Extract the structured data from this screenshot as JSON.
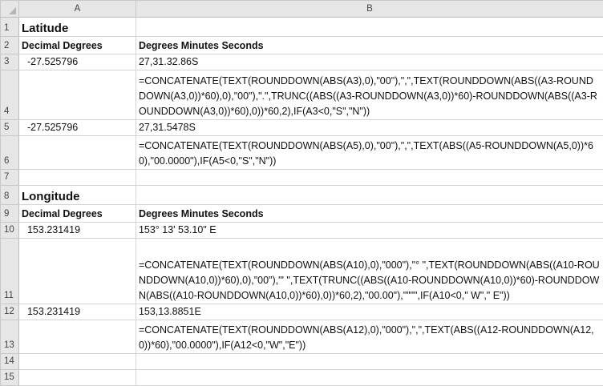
{
  "columns": [
    "A",
    "B"
  ],
  "rows": [
    {
      "num": "1",
      "a": "Latitude",
      "b": ""
    },
    {
      "num": "2",
      "a": "Decimal Degrees",
      "b": "Degrees Minutes Seconds"
    },
    {
      "num": "3",
      "a": "-27.525796",
      "b": "27,31.32.86S"
    },
    {
      "num": "4",
      "a": "",
      "b": "=CONCATENATE(TEXT(ROUNDDOWN(ABS(A3),0),\"00\"),\",\",TEXT(ROUNDDOWN(ABS((A3-ROUNDDOWN(A3,0))*60),0),\"00\"),\".\",TRUNC((ABS((A3-ROUNDDOWN(A3,0))*60)-ROUNDDOWN(ABS((A3-ROUNDDOWN(A3,0))*60),0))*60,2),IF(A3<0,\"S\",\"N\"))"
    },
    {
      "num": "5",
      "a": "-27.525796",
      "b": "27,31.5478S"
    },
    {
      "num": "6",
      "a": "",
      "b": "=CONCATENATE(TEXT(ROUNDDOWN(ABS(A5),0),\"00\"),\",\",TEXT(ABS((A5-ROUNDDOWN(A5,0))*60),\"00.0000\"),IF(A5<0,\"S\",\"N\"))"
    },
    {
      "num": "7",
      "a": "",
      "b": ""
    },
    {
      "num": "8",
      "a": "Longitude",
      "b": ""
    },
    {
      "num": "9",
      "a": "Decimal Degrees",
      "b": "Degrees Minutes Seconds"
    },
    {
      "num": "10",
      "a": "153.231419",
      "b": "153° 13' 53.10\" E"
    },
    {
      "num": "11",
      "a": "",
      "b": "=CONCATENATE(TEXT(ROUNDDOWN(ABS(A10),0),\"000\"),\"° \",TEXT(ROUNDDOWN(ABS((A10-ROUNDDOWN(A10,0))*60),0),\"00\"),\"' \",TEXT(TRUNC((ABS((A10-ROUNDDOWN(A10,0))*60)-ROUNDDOWN(ABS((A10-ROUNDDOWN(A10,0))*60),0))*60,2),\"00.00\"),\"\"\"\",IF(A10<0,\" W\",\" E\"))"
    },
    {
      "num": "12",
      "a": "153.231419",
      "b": "153,13.8851E"
    },
    {
      "num": "13",
      "a": "",
      "b": "=CONCATENATE(TEXT(ROUNDDOWN(ABS(A12),0),\"000\"),\",\",TEXT(ABS((A12-ROUNDDOWN(A12,0))*60),\"00.0000\"),IF(A12<0,\"W\",\"E\"))"
    },
    {
      "num": "14",
      "a": "",
      "b": ""
    },
    {
      "num": "15",
      "a": "",
      "b": ""
    }
  ]
}
